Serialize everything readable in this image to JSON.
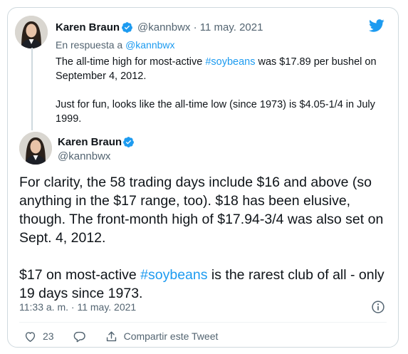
{
  "parent_tweet": {
    "author_name": "Karen Braun",
    "author_handle": "@kannbwx",
    "separator": "·",
    "date": "11 may. 2021",
    "reply_prefix": "En respuesta a",
    "reply_to": "@kannbwx",
    "text_p1_before": "The all-time high for most-active ",
    "text_p1_hashtag": "#soybeans",
    "text_p1_after": " was $17.89 per bushel on September 4, 2012.",
    "text_p2": "Just for fun, looks like the all-time low (since 1973) is $4.05-1/4 in July 1999."
  },
  "main_tweet": {
    "author_name": "Karen Braun",
    "author_handle": "@kannbwx",
    "text_p1": "For clarity, the 58 trading days include $16 and above (so anything in the $17 range, too). $18 has been elusive, though. The front-month high of $17.94-3/4 was also set on Sept. 4, 2012.",
    "text_p2_before": "$17 on most-active ",
    "text_p2_hashtag": "#soybeans",
    "text_p2_after": " is the rarest club of all - only 19 days since 1973.",
    "timestamp": "11:33 a. m. · 11 may. 2021",
    "like_count": "23",
    "share_label": "Compartir este Tweet"
  },
  "icons": {
    "brand": "twitter-bird-icon",
    "verified": "verified-badge-icon",
    "info": "info-icon",
    "like": "heart-icon",
    "reply": "reply-bubble-icon",
    "share": "share-upload-icon"
  },
  "colors": {
    "accent": "#1d9bf0",
    "text_primary": "#0f1419",
    "text_secondary": "#536471",
    "border": "#cfd9de"
  }
}
